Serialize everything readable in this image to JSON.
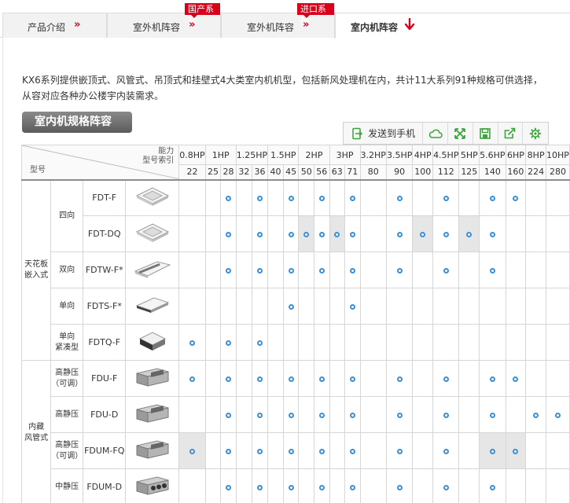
{
  "tabs": [
    {
      "label": "产品介绍",
      "badge": "",
      "active": false
    },
    {
      "label": "室外机阵容",
      "badge": "国产系列",
      "active": false
    },
    {
      "label": "室外机阵容",
      "badge": "进口系列",
      "active": false
    },
    {
      "label": "室内机阵容",
      "badge": "",
      "active": true
    }
  ],
  "tab_arrow": "»",
  "intro_line1": "KX6系列提供嵌顶式、风管式、吊顶式和挂壁式4大类室内机机型，包括新风处理机在内，共计11大系列91种规格可供选择，",
  "intro_line2": "从容对应各种办公楼宇内装需求。",
  "section_title": "室内机规格阵容",
  "toolbar": {
    "send_label": "发送到手机",
    "icons": [
      "phone-send-icon",
      "cloud-icon",
      "expand-icon",
      "save-icon",
      "share-icon",
      "gear-icon"
    ]
  },
  "accent_color": "#d9001b",
  "dot_color": "#3a8fd8",
  "table": {
    "corner_capacity_l1": "能力",
    "corner_capacity_l2": "型号索引",
    "corner_type": "型号",
    "hp_groups": [
      {
        "label": "0.8HP",
        "cols": 1
      },
      {
        "label": "1HP",
        "cols": 2
      },
      {
        "label": "1.25HP",
        "cols": 2
      },
      {
        "label": "1.5HP",
        "cols": 2
      },
      {
        "label": "2HP",
        "cols": 2
      },
      {
        "label": "3HP",
        "cols": 2
      },
      {
        "label": "3.2HP",
        "cols": 1
      },
      {
        "label": "3.5HP",
        "cols": 1
      },
      {
        "label": "4HP",
        "cols": 1
      },
      {
        "label": "4.5HP",
        "cols": 1
      },
      {
        "label": "5HP",
        "cols": 1
      },
      {
        "label": "5.6HP",
        "cols": 1
      },
      {
        "label": "6HP",
        "cols": 1
      },
      {
        "label": "8HP",
        "cols": 1
      },
      {
        "label": "10HP",
        "cols": 1
      }
    ],
    "indices": [
      "22",
      "25",
      "28",
      "32",
      "36",
      "40",
      "45",
      "50",
      "56",
      "63",
      "71",
      "80",
      "90",
      "100",
      "112",
      "125",
      "140",
      "160",
      "224",
      "280"
    ],
    "groups": [
      {
        "label_l1": "天花板",
        "label_l2": "嵌入式",
        "rows": 5
      },
      {
        "label_l1": "内藏",
        "label_l2": "风管式",
        "rows": 4
      }
    ],
    "subtypes": [
      {
        "l1": "四向",
        "l2": "",
        "rows": 2
      },
      {
        "l1": "双向",
        "l2": "",
        "rows": 1
      },
      {
        "l1": "单向",
        "l2": "",
        "rows": 1
      },
      {
        "l1": "单向",
        "l2": "紧凑型",
        "rows": 1
      },
      {
        "l1": "高静压",
        "l2": "（可调）",
        "rows": 1
      },
      {
        "l1": "高静压",
        "l2": "",
        "rows": 1
      },
      {
        "l1": "高静压",
        "l2": "（可调）",
        "rows": 1
      },
      {
        "l1": "中静压",
        "l2": "",
        "rows": 1
      }
    ],
    "rows": [
      {
        "model": "FDT-F",
        "image": "cassette-4way-unit-image",
        "dots": [
          2,
          4,
          6,
          8,
          10,
          12,
          14,
          16,
          17
        ],
        "shaded": []
      },
      {
        "model": "FDT-DQ",
        "image": "cassette-4way-unit-image",
        "dots": [
          2,
          4,
          6,
          7,
          8,
          9,
          10,
          12,
          13,
          14,
          15,
          16
        ],
        "shaded": [
          7,
          9,
          13,
          15
        ]
      },
      {
        "model": "FDTW-F*",
        "image": "cassette-2way-unit-image",
        "dots": [
          2,
          4,
          6,
          8,
          10,
          12,
          14,
          16
        ],
        "shaded": []
      },
      {
        "model": "FDTS-F*",
        "image": "cassette-1way-unit-image",
        "dots": [
          6,
          10
        ],
        "shaded": []
      },
      {
        "model": "FDTQ-F",
        "image": "cassette-compact-unit-image",
        "dots": [
          0,
          2,
          4
        ],
        "shaded": []
      },
      {
        "model": "FDU-F",
        "image": "ducted-unit-image",
        "dots": [
          0,
          2,
          4,
          6,
          8,
          10,
          12,
          14,
          16,
          17
        ],
        "shaded": []
      },
      {
        "model": "FDU-D",
        "image": "ducted-unit-image",
        "dots": [
          2,
          4,
          6,
          8,
          10,
          12,
          14,
          16,
          18,
          19
        ],
        "shaded": []
      },
      {
        "model": "FDUM-FQ",
        "image": "ducted-unit-image",
        "dots": [
          0,
          2,
          4,
          6,
          8,
          10,
          12,
          14,
          16,
          17
        ],
        "shaded": [
          0,
          16,
          17
        ]
      },
      {
        "model": "FDUM-D",
        "image": "ducted-fan-unit-image",
        "dots": [
          2,
          4,
          6,
          8,
          10,
          12,
          14,
          16
        ],
        "shaded": []
      }
    ]
  }
}
